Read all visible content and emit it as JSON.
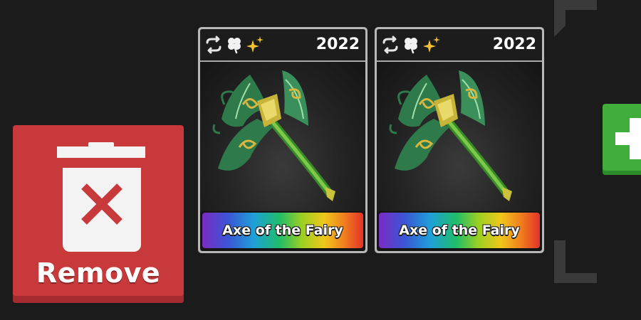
{
  "remove_button": {
    "label": "Remove",
    "icon": "trash-x-icon",
    "color": "#c8393c"
  },
  "cards": [
    {
      "year": "2022",
      "name": "Axe of the Fairy",
      "badges": [
        "swap-icon",
        "clover-icon",
        "sparkle-icon"
      ],
      "art": "fairy-axe-image"
    },
    {
      "year": "2022",
      "name": "Axe of the Fairy",
      "badges": [
        "swap-icon",
        "clover-icon",
        "sparkle-icon"
      ],
      "art": "fairy-axe-image"
    }
  ],
  "add_button": {
    "icon": "plus-icon",
    "color": "#3fae3a"
  },
  "colors": {
    "background": "#1b1b1b",
    "card_border": "#b8b8b8",
    "slot_bracket": "#3a3a3a"
  }
}
